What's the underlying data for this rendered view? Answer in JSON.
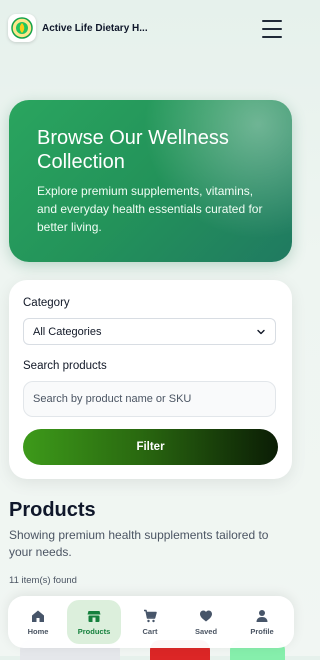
{
  "header": {
    "brand": "Active Life Dietary H...",
    "logo_icon": "leaf-emblem-icon",
    "menu_icon": "hamburger-menu-icon"
  },
  "hero": {
    "title": "Browse Our Wellness Collection",
    "subtitle": "Explore premium supplements, vitamins, and everyday health essentials curated for better living."
  },
  "filters": {
    "category_label": "Category",
    "category_value": "All Categories",
    "search_label": "Search products",
    "search_placeholder": "Search by product name or SKU",
    "search_value": "",
    "filter_button": "Filter"
  },
  "products": {
    "title": "Products",
    "subtitle": "Showing premium health supplements tailored to your needs.",
    "count": "11 item(s) found"
  },
  "bottom_nav": {
    "active": "Products",
    "items": [
      {
        "label": "Home",
        "icon": "home-icon"
      },
      {
        "label": "Products",
        "icon": "store-icon"
      },
      {
        "label": "Cart",
        "icon": "cart-icon"
      },
      {
        "label": "Saved",
        "icon": "heart-icon"
      },
      {
        "label": "Profile",
        "icon": "profile-icon"
      }
    ]
  },
  "colors": {
    "accent_green": "#2aa55f",
    "active_nav": "#15803d",
    "background": "#e6f1ec"
  }
}
